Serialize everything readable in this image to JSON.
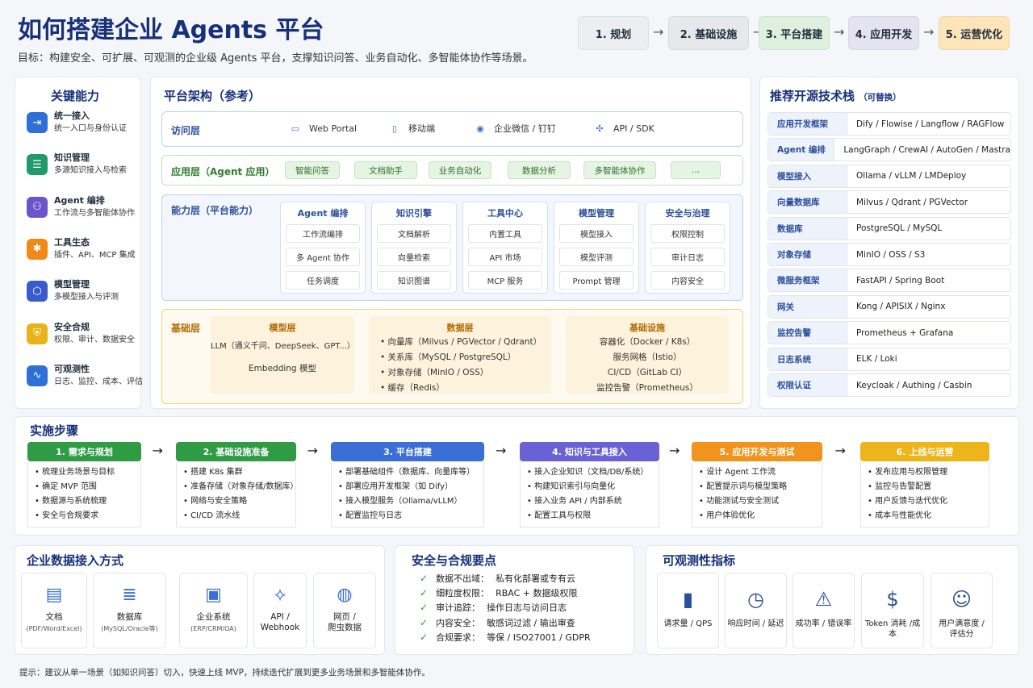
{
  "header": {
    "title": "如何搭建企业 Agents 平台",
    "subtitle": "目标：构建安全、可扩展、可观测的企业级 Agents 平台，支撑知识问答、业务自动化、多智能体协作等场景。",
    "steps": [
      {
        "label": "1. 规划",
        "color": "#eceef2"
      },
      {
        "label": "2. 基础设施",
        "color": "#e7e8ec"
      },
      {
        "label": "3. 平台搭建",
        "color": "#def0de"
      },
      {
        "label": "4. 应用开发",
        "color": "#e6e3f1"
      },
      {
        "label": "5. 运营优化",
        "color": "#fde5b8"
      }
    ],
    "arrow": "→"
  },
  "capabilities": {
    "title": "关键能力",
    "items": [
      {
        "title": "统一接入",
        "desc": "统一入口与身份认证",
        "icon": "login-icon",
        "glyph": "⇥",
        "color": "#2f6fd6"
      },
      {
        "title": "知识管理",
        "desc": "多源知识接入与检索",
        "icon": "book-icon",
        "glyph": "☰",
        "color": "#1f9a6b"
      },
      {
        "title": "Agent 编排",
        "desc": "工作流与多智能体协作",
        "icon": "workflow-icon",
        "glyph": "⚇",
        "color": "#6a55c9"
      },
      {
        "title": "工具生态",
        "desc": "插件、API、MCP 集成",
        "icon": "tools-icon",
        "glyph": "✱",
        "color": "#ef8a1a"
      },
      {
        "title": "模型管理",
        "desc": "多模型接入与评测",
        "icon": "cube-icon",
        "glyph": "⬡",
        "color": "#3a5bd0"
      },
      {
        "title": "安全合规",
        "desc": "权限、审计、数据安全",
        "icon": "shield-icon",
        "glyph": "⛨",
        "color": "#e9b21a"
      },
      {
        "title": "可观测性",
        "desc": "日志、监控、成本、评估",
        "icon": "pulse-icon",
        "glyph": "∿",
        "color": "#2f6fd6"
      }
    ]
  },
  "architecture": {
    "title": "平台架构（参考）",
    "access": {
      "name": "访问层",
      "items": [
        {
          "label": "Web Portal",
          "icon": "monitor-icon",
          "glyph": "▭"
        },
        {
          "label": "移动端",
          "icon": "mobile-icon",
          "glyph": "▯"
        },
        {
          "label": "企业微信 / 钉钉",
          "icon": "chat-icon",
          "glyph": "◉"
        },
        {
          "label": "API / SDK",
          "icon": "api-icon",
          "glyph": "✣"
        }
      ]
    },
    "app": {
      "name": "应用层（Agent 应用）",
      "items": [
        "智能问答",
        "文档助手",
        "业务自动化",
        "数据分析",
        "多智能体协作",
        "..."
      ]
    },
    "capability": {
      "name": "能力层（平台能力）",
      "columns": [
        {
          "title": "Agent 编排",
          "items": [
            "工作流编排",
            "多 Agent 协作",
            "任务调度"
          ]
        },
        {
          "title": "知识引擎",
          "items": [
            "文档解析",
            "向量检索",
            "知识图谱"
          ]
        },
        {
          "title": "工具中心",
          "items": [
            "内置工具",
            "API 市场",
            "MCP 服务"
          ]
        },
        {
          "title": "模型管理",
          "items": [
            "模型接入",
            "模型评测",
            "Prompt 管理"
          ]
        },
        {
          "title": "安全与治理",
          "items": [
            "权限控制",
            "审计日志",
            "内容安全"
          ]
        }
      ]
    },
    "foundation": {
      "name": "基础层",
      "model": {
        "title": "模型层",
        "items": [
          "LLM（通义千问、DeepSeek、GPT...）",
          "Embedding 模型"
        ]
      },
      "data": {
        "title": "数据层",
        "items": [
          "• 向量库（Milvus / PGVector / Qdrant）",
          "• 关系库（MySQL / PostgreSQL）",
          "• 对象存储（MinIO / OSS）",
          "• 缓存（Redis）"
        ]
      },
      "infra": {
        "title": "基础设施",
        "items": [
          "容器化（Docker / K8s）",
          "服务网格（Istio）",
          "CI/CD（GitLab CI）",
          "监控告警（Prometheus）"
        ]
      }
    }
  },
  "techstack": {
    "title": "推荐开源技术栈",
    "note": "（可替换）",
    "rows": [
      {
        "k": "应用开发框架",
        "v": "Dify / Flowise / Langflow / RAGFlow"
      },
      {
        "k": "Agent 编排",
        "v": "LangGraph / CrewAI / AutoGen / Mastra"
      },
      {
        "k": "模型接入",
        "v": "Ollama / vLLM / LMDeploy"
      },
      {
        "k": "向量数据库",
        "v": "Milvus / Qdrant / PGVector"
      },
      {
        "k": "数据库",
        "v": "PostgreSQL / MySQL"
      },
      {
        "k": "对象存储",
        "v": "MinIO / OSS / S3"
      },
      {
        "k": "微服务框架",
        "v": "FastAPI / Spring Boot"
      },
      {
        "k": "网关",
        "v": "Kong / APISIX / Nginx"
      },
      {
        "k": "监控告警",
        "v": "Prometheus + Grafana"
      },
      {
        "k": "日志系统",
        "v": "ELK / Loki"
      },
      {
        "k": "权限认证",
        "v": "Keycloak / Authing / Casbin"
      }
    ]
  },
  "implementation": {
    "title": "实施步骤",
    "phases": [
      {
        "title": "1. 需求与规划",
        "color": "#2f9b45",
        "items": [
          "• 梳理业务场景与目标",
          "• 确定 MVP 范围",
          "• 数据源与系统梳理",
          "• 安全与合规要求"
        ]
      },
      {
        "title": "2. 基础设施准备",
        "color": "#2f9b45",
        "items": [
          "• 搭建 K8s 集群",
          "• 准备存储（对象存储/数据库）",
          "• 网络与安全策略",
          "• CI/CD 流水线"
        ]
      },
      {
        "title": "3. 平台搭建",
        "color": "#3b6fd6",
        "items": [
          "• 部署基础组件（数据库、向量库等）",
          "• 部署应用开发框架（如 Dify）",
          "• 接入模型服务（Ollama/vLLM）",
          "• 配置监控与日志"
        ]
      },
      {
        "title": "4. 知识与工具接入",
        "color": "#6a62d4",
        "items": [
          "• 接入企业知识（文档/DB/系统）",
          "• 构建知识索引与向量化",
          "• 接入业务 API / 内部系统",
          "• 配置工具与权限"
        ]
      },
      {
        "title": "5. 应用开发与测试",
        "color": "#f0941e",
        "items": [
          "• 设计 Agent 工作流",
          "• 配置提示词与模型策略",
          "• 功能测试与安全测试",
          "• 用户体验优化"
        ]
      },
      {
        "title": "6. 上线与运营",
        "color": "#edb51c",
        "items": [
          "• 发布应用与权限管理",
          "• 监控与告警配置",
          "• 用户反馈与迭代优化",
          "• 成本与性能优化"
        ]
      }
    ],
    "arrow": "→"
  },
  "datasources": {
    "title": "企业数据接入方式",
    "items": [
      {
        "title": "文档",
        "desc": "(PDF/Word/Excel)",
        "icon": "document-icon",
        "glyph": "▤"
      },
      {
        "title": "数据库",
        "desc": "(MySQL/Oracle等)",
        "icon": "database-icon",
        "glyph": "≣"
      },
      {
        "title": "企业系统",
        "desc": "(ERP/CRM/OA)",
        "icon": "briefcase-icon",
        "glyph": "▣"
      },
      {
        "title": "API /\nWebhook",
        "desc": "",
        "icon": "webhook-icon",
        "glyph": "⟡"
      },
      {
        "title": "网页 /\n爬虫数据",
        "desc": "",
        "icon": "globe-icon",
        "glyph": "◍"
      }
    ]
  },
  "security": {
    "title": "安全与合规要点",
    "check": "✓",
    "items": [
      {
        "k": "数据不出域：",
        "v": "私有化部署或专有云"
      },
      {
        "k": "细粒度权限：",
        "v": "RBAC + 数据级权限"
      },
      {
        "k": "审计追踪：",
        "v": "操作日志与访问日志"
      },
      {
        "k": "内容安全：",
        "v": "敏感词过滤 / 输出审查"
      },
      {
        "k": "合规要求：",
        "v": "等保 / ISO27001 / GDPR"
      }
    ]
  },
  "observability": {
    "title": "可观测性指标",
    "items": [
      {
        "label": "请求量 / QPS",
        "icon": "bar-chart-icon",
        "glyph": "▮"
      },
      {
        "label": "响应时间 / 延迟",
        "icon": "clock-icon",
        "glyph": "◷"
      },
      {
        "label": "成功率 / 错误率",
        "icon": "warning-icon",
        "glyph": "⚠"
      },
      {
        "label": "Token 消耗 /成本",
        "icon": "dollar-icon",
        "glyph": "$"
      },
      {
        "label": "用户满意度 /\n评估分",
        "icon": "smile-icon",
        "glyph": "☺"
      }
    ]
  },
  "tip": "提示：建议从单一场景（如知识问答）切入，快速上线 MVP，持续迭代扩展到更多业务场景和多智能体协作。"
}
